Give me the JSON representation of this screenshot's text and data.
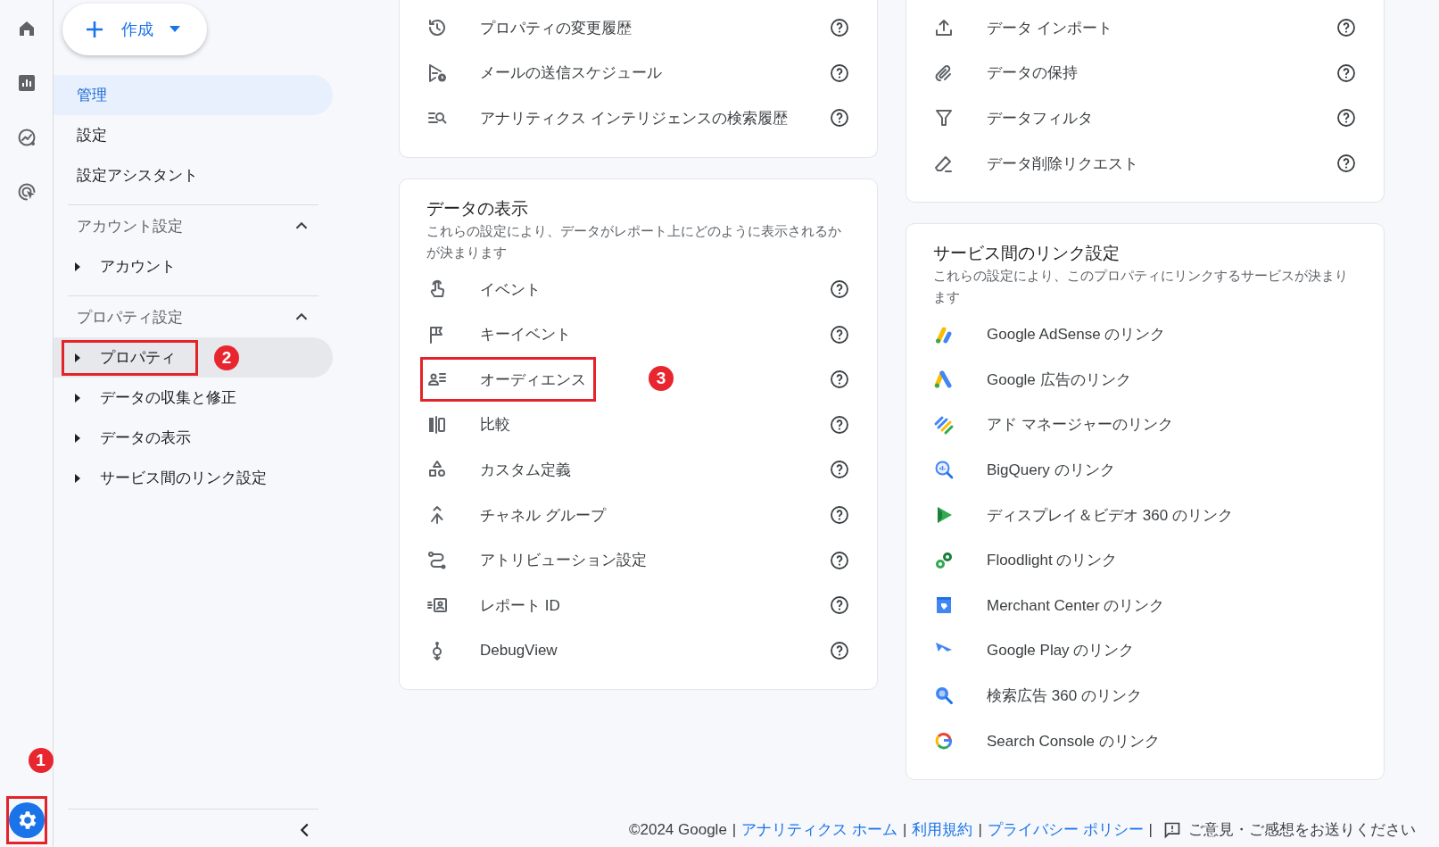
{
  "rail": {
    "items": [
      {
        "selected": false
      },
      {
        "selected": false
      },
      {
        "selected": false
      },
      {
        "selected": false
      }
    ],
    "admin": {
      "selected": true,
      "outlined": true,
      "callout": "1"
    }
  },
  "create_button": {
    "label": "作成"
  },
  "nav": [
    {
      "label": "管理",
      "selected": true
    },
    {
      "label": "設定",
      "selected": false
    },
    {
      "label": "設定アシスタント",
      "selected": false
    }
  ],
  "sections": [
    {
      "title": "アカウント設定",
      "expanded": true,
      "items": [
        {
          "label": "アカウント",
          "expanded": false,
          "selected": false,
          "outlined": false
        }
      ]
    },
    {
      "title": "プロパティ設定",
      "expanded": true,
      "items": [
        {
          "label": "プロパティ",
          "expanded": false,
          "selected": true,
          "outlined": true,
          "callout": "2"
        },
        {
          "label": "データの収集と修正",
          "expanded": false,
          "selected": false,
          "outlined": false
        },
        {
          "label": "データの表示",
          "expanded": false,
          "selected": false,
          "outlined": false
        },
        {
          "label": "サービス間のリンク設定",
          "expanded": false,
          "selected": false,
          "outlined": false
        }
      ]
    }
  ],
  "columns": [
    [
      {
        "items": [
          {
            "label": "プロパティの変更履歴",
            "help": true,
            "outlined": false
          },
          {
            "label": "メールの送信スケジュール",
            "help": true,
            "outlined": false
          },
          {
            "label": "アナリティクス インテリジェンスの検索履歴",
            "help": true,
            "outlined": false
          }
        ]
      },
      {
        "title": "データの表示",
        "description": "これらの設定により、データがレポート上にどのように表示されるかが決まります",
        "items": [
          {
            "label": "イベント",
            "help": true,
            "outlined": false
          },
          {
            "label": "キーイベント",
            "help": true,
            "outlined": false
          },
          {
            "label": "オーディエンス",
            "help": true,
            "outlined": true,
            "callout": "3"
          },
          {
            "label": "比較",
            "help": true,
            "outlined": false
          },
          {
            "label": "カスタム定義",
            "help": true,
            "outlined": false
          },
          {
            "label": "チャネル グループ",
            "help": true,
            "outlined": false
          },
          {
            "label": "アトリビューション設定",
            "help": true,
            "outlined": false
          },
          {
            "label": "レポート ID",
            "help": true,
            "outlined": false
          },
          {
            "label": "DebugView",
            "help": true,
            "outlined": false
          }
        ]
      }
    ],
    [
      {
        "items": [
          {
            "label": "データ インポート",
            "help": true,
            "outlined": false
          },
          {
            "label": "データの保持",
            "help": true,
            "outlined": false
          },
          {
            "label": "データフィルタ",
            "help": true,
            "outlined": false
          },
          {
            "label": "データ削除リクエスト",
            "help": true,
            "outlined": false
          }
        ]
      },
      {
        "title": "サービス間のリンク設定",
        "description": "これらの設定により、このプロパティにリンクするサービスが決まります",
        "items": [
          {
            "label": "Google AdSense のリンク",
            "help": false,
            "outlined": false
          },
          {
            "label": "Google 広告のリンク",
            "help": false,
            "outlined": false
          },
          {
            "label": "アド マネージャーのリンク",
            "help": false,
            "outlined": false
          },
          {
            "label": "BigQuery のリンク",
            "help": false,
            "outlined": false
          },
          {
            "label": "ディスプレイ＆ビデオ 360 のリンク",
            "help": false,
            "outlined": false
          },
          {
            "label": "Floodlight のリンク",
            "help": false,
            "outlined": false
          },
          {
            "label": "Merchant Center のリンク",
            "help": false,
            "outlined": false
          },
          {
            "label": "Google Play のリンク",
            "help": false,
            "outlined": false
          },
          {
            "label": "検索広告 360 のリンク",
            "help": false,
            "outlined": false
          },
          {
            "label": "Search Console のリンク",
            "help": false,
            "outlined": false
          }
        ]
      }
    ]
  ],
  "footer": {
    "parts": [
      {
        "kind": "text",
        "text": "©2024 Google"
      },
      {
        "kind": "separator",
        "text": "|"
      },
      {
        "kind": "link",
        "text": "アナリティクス ホーム"
      },
      {
        "kind": "separator",
        "text": "|"
      },
      {
        "kind": "link",
        "text": "利用規約"
      },
      {
        "kind": "separator",
        "text": "|"
      },
      {
        "kind": "link",
        "text": "プライバシー ポリシー"
      },
      {
        "kind": "separator",
        "text": "|"
      },
      {
        "kind": "feedback",
        "text": "ご意見・ご感想をお送りください"
      }
    ]
  }
}
